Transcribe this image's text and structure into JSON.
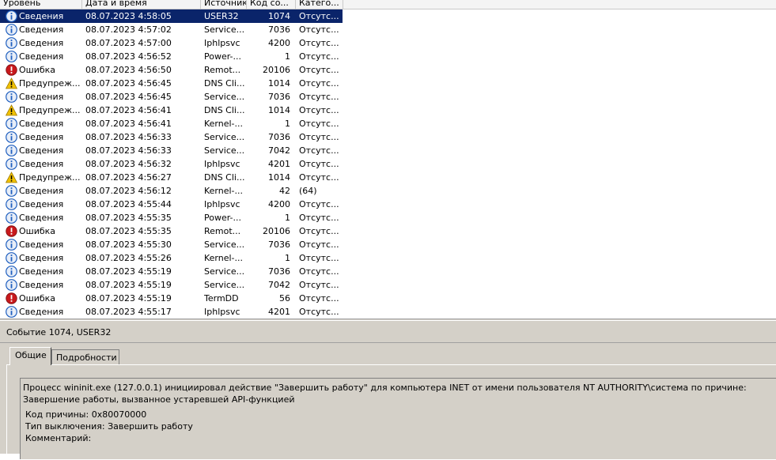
{
  "columns": {
    "level": "Уровень",
    "datetime": "Дата и время",
    "source": "Источник",
    "code": "Код со...",
    "category": "Катего..."
  },
  "rows": [
    {
      "level": "Сведения",
      "type": "info",
      "datetime": "08.07.2023 4:58:05",
      "source": "USER32",
      "code": "1074",
      "category": "Отсутс..."
    },
    {
      "level": "Сведения",
      "type": "info",
      "datetime": "08.07.2023 4:57:02",
      "source": "Service...",
      "code": "7036",
      "category": "Отсутс..."
    },
    {
      "level": "Сведения",
      "type": "info",
      "datetime": "08.07.2023 4:57:00",
      "source": "Iphlpsvc",
      "code": "4200",
      "category": "Отсутс..."
    },
    {
      "level": "Сведения",
      "type": "info",
      "datetime": "08.07.2023 4:56:52",
      "source": "Power-...",
      "code": "1",
      "category": "Отсутс..."
    },
    {
      "level": "Ошибка",
      "type": "error",
      "datetime": "08.07.2023 4:56:50",
      "source": "Remot...",
      "code": "20106",
      "category": "Отсутс..."
    },
    {
      "level": "Предупреж...",
      "type": "warning",
      "datetime": "08.07.2023 4:56:45",
      "source": "DNS Cli...",
      "code": "1014",
      "category": "Отсутс..."
    },
    {
      "level": "Сведения",
      "type": "info",
      "datetime": "08.07.2023 4:56:45",
      "source": "Service...",
      "code": "7036",
      "category": "Отсутс..."
    },
    {
      "level": "Предупреж...",
      "type": "warning",
      "datetime": "08.07.2023 4:56:41",
      "source": "DNS Cli...",
      "code": "1014",
      "category": "Отсутс..."
    },
    {
      "level": "Сведения",
      "type": "info",
      "datetime": "08.07.2023 4:56:41",
      "source": "Kernel-...",
      "code": "1",
      "category": "Отсутс..."
    },
    {
      "level": "Сведения",
      "type": "info",
      "datetime": "08.07.2023 4:56:33",
      "source": "Service...",
      "code": "7036",
      "category": "Отсутс..."
    },
    {
      "level": "Сведения",
      "type": "info",
      "datetime": "08.07.2023 4:56:33",
      "source": "Service...",
      "code": "7042",
      "category": "Отсутс..."
    },
    {
      "level": "Сведения",
      "type": "info",
      "datetime": "08.07.2023 4:56:32",
      "source": "Iphlpsvc",
      "code": "4201",
      "category": "Отсутс..."
    },
    {
      "level": "Предупреж...",
      "type": "warning",
      "datetime": "08.07.2023 4:56:27",
      "source": "DNS Cli...",
      "code": "1014",
      "category": "Отсутс..."
    },
    {
      "level": "Сведения",
      "type": "info",
      "datetime": "08.07.2023 4:56:12",
      "source": "Kernel-...",
      "code": "42",
      "category": "(64)"
    },
    {
      "level": "Сведения",
      "type": "info",
      "datetime": "08.07.2023 4:55:44",
      "source": "Iphlpsvc",
      "code": "4200",
      "category": "Отсутс..."
    },
    {
      "level": "Сведения",
      "type": "info",
      "datetime": "08.07.2023 4:55:35",
      "source": "Power-...",
      "code": "1",
      "category": "Отсутс..."
    },
    {
      "level": "Ошибка",
      "type": "error",
      "datetime": "08.07.2023 4:55:35",
      "source": "Remot...",
      "code": "20106",
      "category": "Отсутс..."
    },
    {
      "level": "Сведения",
      "type": "info",
      "datetime": "08.07.2023 4:55:30",
      "source": "Service...",
      "code": "7036",
      "category": "Отсутс..."
    },
    {
      "level": "Сведения",
      "type": "info",
      "datetime": "08.07.2023 4:55:26",
      "source": "Kernel-...",
      "code": "1",
      "category": "Отсутс..."
    },
    {
      "level": "Сведения",
      "type": "info",
      "datetime": "08.07.2023 4:55:19",
      "source": "Service...",
      "code": "7036",
      "category": "Отсутс..."
    },
    {
      "level": "Сведения",
      "type": "info",
      "datetime": "08.07.2023 4:55:19",
      "source": "Service...",
      "code": "7042",
      "category": "Отсутс..."
    },
    {
      "level": "Ошибка",
      "type": "error",
      "datetime": "08.07.2023 4:55:19",
      "source": "TermDD",
      "code": "56",
      "category": "Отсутс..."
    },
    {
      "level": "Сведения",
      "type": "info",
      "datetime": "08.07.2023 4:55:17",
      "source": "Iphlpsvc",
      "code": "4201",
      "category": "Отсутс..."
    }
  ],
  "selected_row": 0,
  "details": {
    "title": "Событие 1074, USER32",
    "tabs": [
      {
        "label": "Общие",
        "active": true
      },
      {
        "label": "Подробности",
        "active": false
      }
    ],
    "description": "Процесс wininit.exe (127.0.0.1) инициировал действие \"Завершить работу\" для компьютера INET от имени пользователя NT AUTHORITY\\система по причине: Завершение работы, вызванное устаревшей API-функцией",
    "reason_code": "Код причины: 0x80070000",
    "shutdown_type": "Тип выключения: Завершить работу",
    "comment": "Комментарий:"
  },
  "icons": {
    "info": "info-icon",
    "warning": "warning-icon",
    "error": "error-icon"
  },
  "colors": {
    "selection": "#0a246a",
    "panel": "#d4d0c8",
    "info": "#1f5fbf",
    "warning": "#f2c200",
    "error": "#c8191c"
  }
}
